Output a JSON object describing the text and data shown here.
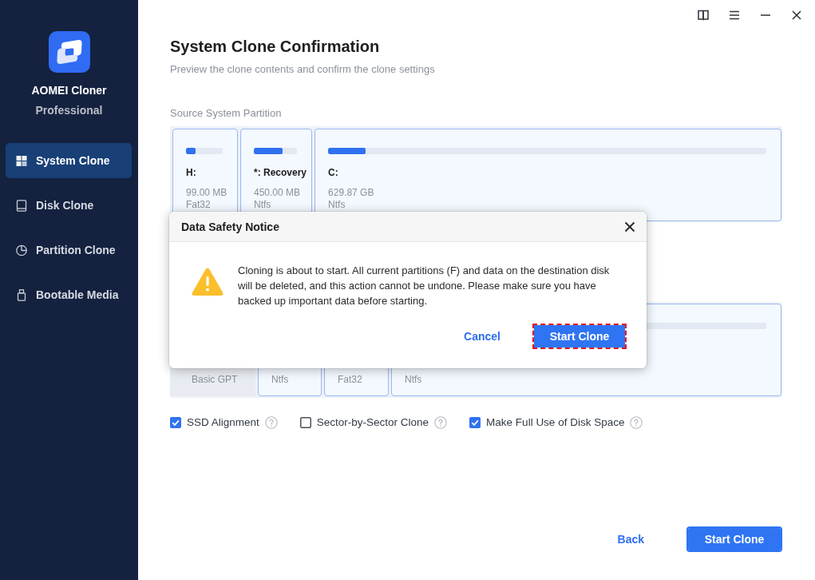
{
  "sidebar": {
    "app_name": "AOMEI Cloner",
    "edition": "Professional",
    "items": [
      {
        "label": "System Clone",
        "selected": true
      },
      {
        "label": "Disk Clone",
        "selected": false
      },
      {
        "label": "Partition Clone",
        "selected": false
      },
      {
        "label": "Bootable Media",
        "selected": false
      }
    ]
  },
  "page": {
    "title": "System Clone Confirmation",
    "subtitle": "Preview the clone contents and confirm the clone settings"
  },
  "source": {
    "heading": "Source System Partition",
    "partitions": [
      {
        "label": "H:",
        "size": "99.00 MB",
        "file_system": "Fat32",
        "level": 0.255
      },
      {
        "label": "*: Recovery",
        "size": "450.00 MB",
        "file_system": "Ntfs",
        "level": 0.66
      },
      {
        "label": "C:",
        "size": "629.87 GB",
        "file_system": "Ntfs",
        "level": 0.086
      }
    ]
  },
  "destination": {
    "disk_type": "Basic GPT",
    "partitions": [
      {
        "file_system": "Ntfs",
        "usage_bar": false
      },
      {
        "file_system": "Fat32",
        "usage_bar": false
      },
      {
        "file_system": "Ntfs",
        "usage_bar": true
      }
    ]
  },
  "options": [
    {
      "label": "SSD Alignment",
      "checked": true
    },
    {
      "label": "Sector-by-Sector Clone",
      "checked": false
    },
    {
      "label": "Make Full Use of Disk Space",
      "checked": true
    }
  ],
  "footer": {
    "back": "Back",
    "start": "Start Clone"
  },
  "dialog": {
    "title": "Data Safety Notice",
    "message": "Cloning is about to start. All current partitions (F) and data on the destination disk will be deleted, and this action cannot be undone. Please make sure you have backed up important data before starting.",
    "cancel": "Cancel",
    "confirm": {
      "label": "Start Clone",
      "highlighted": true
    }
  }
}
